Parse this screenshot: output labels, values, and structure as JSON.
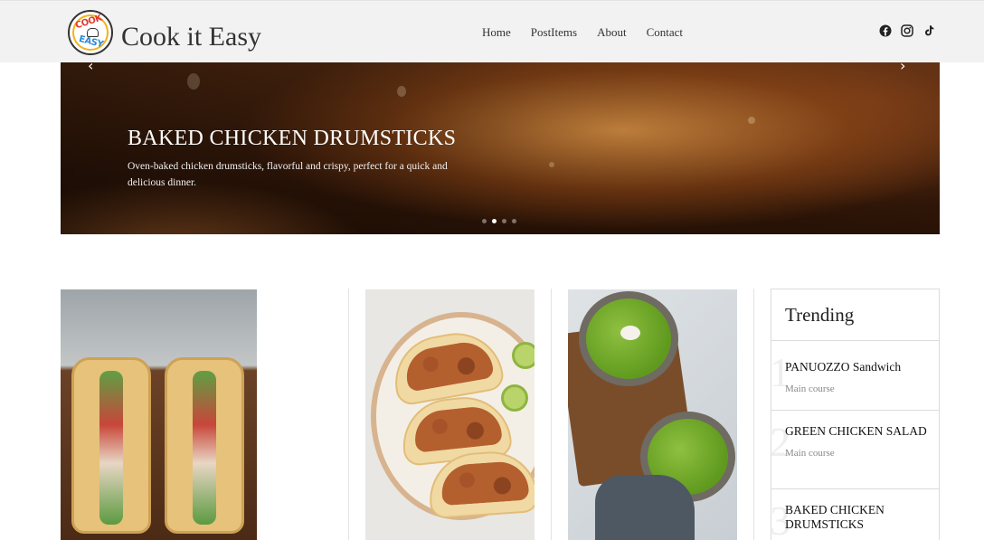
{
  "header": {
    "brand": "Cook it Easy",
    "logo": {
      "top_text": "COOK",
      "bottom_text": "EASY"
    },
    "nav": [
      "Home",
      "PostItems",
      "About",
      "Contact"
    ],
    "social_icons": [
      "facebook-icon",
      "instagram-icon",
      "tiktok-icon"
    ]
  },
  "hero": {
    "title": "BAKED CHICKEN DRUMSTICKS",
    "description": "Oven-baked chicken drumsticks, flavorful and crispy, perfect for a quick and delicious dinner.",
    "prev_glyph": "‹",
    "next_glyph": "›",
    "slides_count": 4,
    "active_slide": 2
  },
  "cards": [
    {
      "image": "sandwich-photo"
    },
    {
      "image": "tacos-photo"
    },
    {
      "image": "green-soup-photo"
    }
  ],
  "trending": {
    "heading": "Trending",
    "items": [
      {
        "num": "1",
        "name": "PANUOZZO Sandwich",
        "category": "Main course"
      },
      {
        "num": "2",
        "name": "GREEN CHICKEN SALAD",
        "category": "Main course"
      },
      {
        "num": "3",
        "name": "BAKED CHICKEN DRUMSTICKS",
        "category": ""
      }
    ]
  },
  "colors": {
    "header_bg": "#f2f2f2",
    "text": "#333333",
    "muted": "#888888"
  }
}
